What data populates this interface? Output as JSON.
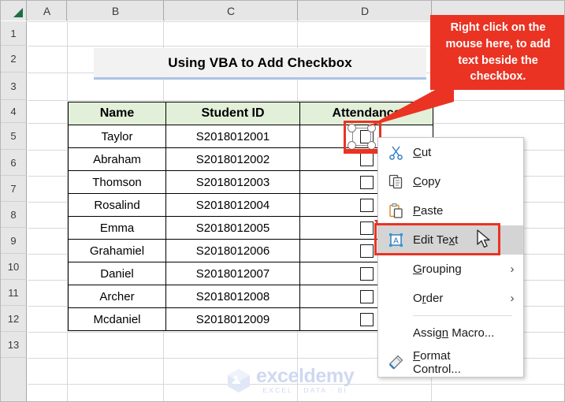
{
  "spreadsheet": {
    "column_headers": [
      "A",
      "B",
      "C",
      "D"
    ],
    "row_headers": [
      "1",
      "2",
      "3",
      "4",
      "5",
      "6",
      "7",
      "8",
      "9",
      "10",
      "11",
      "12",
      "13"
    ],
    "select_all_icon": "select-all-triangle-icon",
    "banner_title": "Using VBA to Add Checkbox",
    "accent_colors": {
      "banner_fill": "#f2f2f2",
      "banner_underline": "#a9c4e4",
      "table_header_fill": "#e2efd9",
      "header_band_fill": "#e6e6e6",
      "annotation_red": "#ea3323",
      "select_all_green": "#1d6f42"
    }
  },
  "table": {
    "headers": [
      "Name",
      "Student ID",
      "Attendance"
    ],
    "rows": [
      {
        "name": "Taylor",
        "student_id": "S2018012001",
        "attendance": "unchecked-checkbox"
      },
      {
        "name": "Abraham",
        "student_id": "S2018012002",
        "attendance": "unchecked-checkbox"
      },
      {
        "name": "Thomson",
        "student_id": "S2018012003",
        "attendance": "unchecked-checkbox"
      },
      {
        "name": "Rosalind",
        "student_id": "S2018012004",
        "attendance": "unchecked-checkbox"
      },
      {
        "name": "Emma",
        "student_id": "S2018012005",
        "attendance": "unchecked-checkbox"
      },
      {
        "name": "Grahamiel",
        "student_id": "S2018012006",
        "attendance": "unchecked-checkbox"
      },
      {
        "name": "Daniel",
        "student_id": "S2018012007",
        "attendance": "unchecked-checkbox"
      },
      {
        "name": "Archer",
        "student_id": "S2018012008",
        "attendance": "unchecked-checkbox"
      },
      {
        "name": "Mcdaniel",
        "student_id": "S2018012009",
        "attendance": "unchecked-checkbox"
      }
    ]
  },
  "callout": {
    "text": "Right click on the mouse here, to add text beside the checkbox.",
    "background": "#ea3323",
    "text_color": "#ffffff"
  },
  "context_menu": {
    "items": [
      {
        "label": "Cut",
        "icon": "scissors-icon",
        "accel": "C",
        "submenu": false,
        "highlighted": false,
        "separator_before": false
      },
      {
        "label": "Copy",
        "icon": "copy-icon",
        "accel": "C",
        "submenu": false,
        "highlighted": false,
        "separator_before": false
      },
      {
        "label": "Paste",
        "icon": "paste-icon",
        "accel": "P",
        "submenu": false,
        "highlighted": false,
        "separator_before": false
      },
      {
        "label": "Edit Text",
        "icon": "edit-text-icon",
        "accel": "x",
        "submenu": false,
        "highlighted": true,
        "separator_before": false
      },
      {
        "label": "Grouping",
        "icon": "",
        "accel": "G",
        "submenu": true,
        "highlighted": false,
        "separator_before": false
      },
      {
        "label": "Order",
        "icon": "",
        "accel": "r",
        "submenu": true,
        "highlighted": false,
        "separator_before": false
      },
      {
        "label": "Assign Macro...",
        "icon": "",
        "accel": "n",
        "submenu": false,
        "highlighted": false,
        "separator_before": true
      },
      {
        "label": "Format Control...",
        "icon": "format-control-icon",
        "accel": "F",
        "submenu": false,
        "highlighted": false,
        "separator_before": false
      }
    ],
    "submenu_glyph": "›"
  },
  "selection": {
    "selected_shape": "checkbox-shape-selected",
    "handle_count": 4
  },
  "watermark": {
    "title": "exceldemy",
    "subtitle": "EXCEL · DATA · BI",
    "logo": "cube-logo-icon"
  }
}
